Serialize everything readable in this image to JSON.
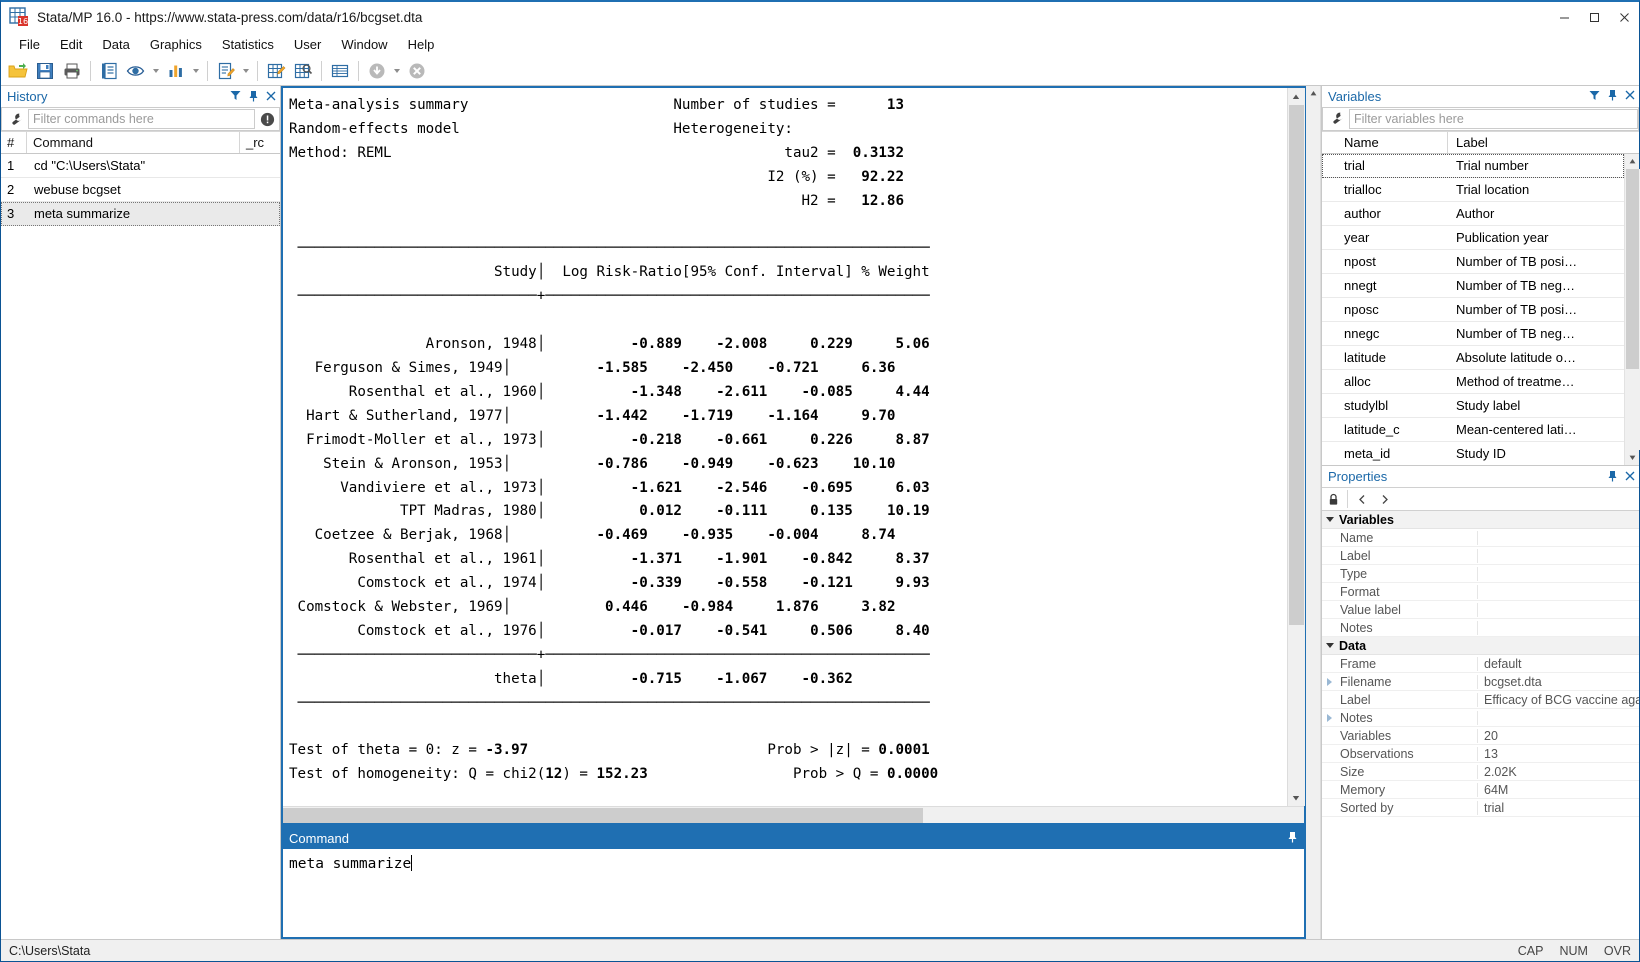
{
  "window": {
    "title": "Stata/MP 16.0 - https://www.stata-press.com/data/r16/bcgset.dta",
    "minimize": "–",
    "maximize": "☐",
    "close": "✕"
  },
  "menubar": {
    "items": [
      "File",
      "Edit",
      "Data",
      "Graphics",
      "Statistics",
      "User",
      "Window",
      "Help"
    ]
  },
  "toolbar": {
    "icons": [
      "open-folder-icon",
      "save-icon",
      "print-icon",
      "log-icon",
      "viewer-icon",
      "graph-icon",
      "do-editor-icon",
      "data-editor-edit-icon",
      "data-editor-browse-icon",
      "variables-manager-icon",
      "break-icon",
      "stop-icon"
    ]
  },
  "history": {
    "title": "History",
    "filter_placeholder": "Filter commands here",
    "columns": {
      "num": "#",
      "command": "Command",
      "rc": "_rc"
    },
    "rows": [
      {
        "num": "1",
        "command": "cd \"C:\\Users\\Stata\"",
        "rc": ""
      },
      {
        "num": "2",
        "command": "webuse bcgset",
        "rc": ""
      },
      {
        "num": "3",
        "command": "meta summarize",
        "rc": ""
      }
    ]
  },
  "results": {
    "text": "Meta-analysis summary                       Number of studies =      |13|\nRandom-effects model                        Heterogeneity:\nMethod: REML                                             tau2 =  |0.3132|\n                                                       I2 (%) =   |92.22|\n                                                          H2 =   |12.86|\n\n  ------------------------------------------------------------------------\n                      Study | Log Risk-Ratio    [95% Conf. Interval] % Weight\n  --------------------------+---------------------------------------------\n             Aronson, 1948  |        |-0.889|        |-2.008|        |0.229|     |5.06|\n     Ferguson & Simes, 1949 |        |-1.585|        |-2.450|       |-0.721|     |6.36|\n     Rosenthal et al., 1960 |        |-1.348|        |-2.611|       |-0.085|     |4.44|\n     Hart & Sutherland, 1977|        |-1.442|        |-1.719|       |-1.164|     |9.70|\nFrimodt-Moller et al., 1973 |        |-0.218|        |-0.661|        |0.226|     |8.87|\n       Stein & Aronson, 1953|        |-0.786|        |-0.949|       |-0.623|    |10.10|\n    Vandiviere et al., 1973 |        |-1.621|        |-2.546|       |-0.695|     |6.03|\n            TPT Madras, 1980|         |0.012|        |-0.111|        |0.135|    |10.19|\n     Coetzee & Berjak, 1968 |        |-0.469|        |-0.935|       |-0.004|     |8.74|\n     Rosenthal et al., 1961 |        |-1.371|        |-1.901|       |-0.842|     |8.37|\n     Comstock et al., 1974  |        |-0.339|        |-0.558|       |-0.121|     |9.93|\n   Comstock & Webster, 1969 |         |0.446|        |-0.984|        |1.876|     |3.82|\n     Comstock et al., 1976  |        |-0.017|        |-0.541|        |0.506|     |8.40|\n  --------------------------+---------------------------------------------\n                      theta |        |-0.715|        |-1.067|       |-0.362|\n  ------------------------------------------------------------------------"
  },
  "output": {
    "header_left": [
      "Meta-analysis summary",
      "Random-effects model",
      "Method: REML"
    ],
    "header_right": [
      {
        "label": "Number of studies =",
        "value": "13"
      },
      {
        "label": "Heterogeneity:",
        "value": ""
      },
      {
        "label": "tau2 =",
        "value": "0.3132"
      },
      {
        "label": "I2 (%) =",
        "value": "92.22"
      },
      {
        "label": "H2 =",
        "value": "12.86"
      }
    ],
    "table_headers": [
      "Study",
      "Log Risk-Ratio",
      "[95% Conf. Interval]",
      "% Weight"
    ],
    "rows": [
      {
        "study": "Aronson, 1948",
        "est": "-0.889",
        "ll": "-2.008",
        "ul": "0.229",
        "weight": "5.06"
      },
      {
        "study": "Ferguson & Simes, 1949",
        "est": "-1.585",
        "ll": "-2.450",
        "ul": "-0.721",
        "weight": "6.36"
      },
      {
        "study": "Rosenthal et al., 1960",
        "est": "-1.348",
        "ll": "-2.611",
        "ul": "-0.085",
        "weight": "4.44"
      },
      {
        "study": "Hart & Sutherland, 1977",
        "est": "-1.442",
        "ll": "-1.719",
        "ul": "-1.164",
        "weight": "9.70"
      },
      {
        "study": "Frimodt-Moller et al., 1973",
        "est": "-0.218",
        "ll": "-0.661",
        "ul": "0.226",
        "weight": "8.87"
      },
      {
        "study": "Stein & Aronson, 1953",
        "est": "-0.786",
        "ll": "-0.949",
        "ul": "-0.623",
        "weight": "10.10"
      },
      {
        "study": "Vandiviere et al., 1973",
        "est": "-1.621",
        "ll": "-2.546",
        "ul": "-0.695",
        "weight": "6.03"
      },
      {
        "study": "TPT Madras, 1980",
        "est": "0.012",
        "ll": "-0.111",
        "ul": "0.135",
        "weight": "10.19"
      },
      {
        "study": "Coetzee & Berjak, 1968",
        "est": "-0.469",
        "ll": "-0.935",
        "ul": "-0.004",
        "weight": "8.74"
      },
      {
        "study": "Rosenthal et al., 1961",
        "est": "-1.371",
        "ll": "-1.901",
        "ul": "-0.842",
        "weight": "8.37"
      },
      {
        "study": "Comstock et al., 1974",
        "est": "-0.339",
        "ll": "-0.558",
        "ul": "-0.121",
        "weight": "9.93"
      },
      {
        "study": "Comstock & Webster, 1969",
        "est": "0.446",
        "ll": "-0.984",
        "ul": "1.876",
        "weight": "3.82"
      },
      {
        "study": "Comstock et al., 1976",
        "est": "-0.017",
        "ll": "-0.541",
        "ul": "0.506",
        "weight": "8.40"
      }
    ],
    "overall": {
      "study": "theta",
      "est": "-0.715",
      "ll": "-1.067",
      "ul": "-0.362",
      "weight": ""
    },
    "tests": [
      {
        "left_label": "Test of theta = 0: z =",
        "left_value": "-3.97",
        "right_label": "Prob > |z| =",
        "right_value": "0.0001"
      },
      {
        "left_label": "Test of homogeneity: Q = chi2(",
        "left_value": "12",
        "left_label2": ") =",
        "left_value2": "152.23",
        "right_label": "Prob > Q =",
        "right_value": "0.0000"
      }
    ],
    "prompt": "."
  },
  "command": {
    "title": "Command",
    "pin_icon": "pin-icon",
    "value": "meta summarize"
  },
  "variables": {
    "title": "Variables",
    "filter_placeholder": "Filter variables here",
    "columns": {
      "name": "Name",
      "label": "Label"
    },
    "rows": [
      {
        "name": "trial",
        "label": "Trial number",
        "selected": true
      },
      {
        "name": "trialloc",
        "label": "Trial location",
        "selected": false
      },
      {
        "name": "author",
        "label": "Author",
        "selected": false
      },
      {
        "name": "year",
        "label": "Publication year",
        "selected": false
      },
      {
        "name": "npost",
        "label": "Number of TB posi…",
        "selected": false
      },
      {
        "name": "nnegt",
        "label": "Number of TB neg…",
        "selected": false
      },
      {
        "name": "nposc",
        "label": "Number of TB posi…",
        "selected": false
      },
      {
        "name": "nnegc",
        "label": "Number of TB neg…",
        "selected": false
      },
      {
        "name": "latitude",
        "label": "Absolute latitude o…",
        "selected": false
      },
      {
        "name": "alloc",
        "label": "Method of treatme…",
        "selected": false
      },
      {
        "name": "studylbl",
        "label": "Study label",
        "selected": false
      },
      {
        "name": "latitude_c",
        "label": "Mean-centered lati…",
        "selected": false
      },
      {
        "name": "meta_id",
        "label": "Study ID",
        "selected": false
      }
    ]
  },
  "properties": {
    "title": "Properties",
    "toolbar_icons": [
      "lock-icon",
      "chevron-left-icon",
      "chevron-right-icon"
    ],
    "groups": [
      {
        "name": "Variables",
        "rows": [
          {
            "key": "Name",
            "value": "",
            "expandable": false
          },
          {
            "key": "Label",
            "value": "",
            "expandable": false
          },
          {
            "key": "Type",
            "value": "",
            "expandable": false
          },
          {
            "key": "Format",
            "value": "",
            "expandable": false
          },
          {
            "key": "Value label",
            "value": "",
            "expandable": false
          },
          {
            "key": "Notes",
            "value": "",
            "expandable": false
          }
        ]
      },
      {
        "name": "Data",
        "rows": [
          {
            "key": "Frame",
            "value": "default",
            "expandable": false
          },
          {
            "key": "Filename",
            "value": "bcgset.dta",
            "expandable": true
          },
          {
            "key": "Label",
            "value": "Efficacy of BCG vaccine again",
            "expandable": false
          },
          {
            "key": "Notes",
            "value": "",
            "expandable": true
          },
          {
            "key": "Variables",
            "value": "20",
            "expandable": false
          },
          {
            "key": "Observations",
            "value": "13",
            "expandable": false
          },
          {
            "key": "Size",
            "value": "2.02K",
            "expandable": false
          },
          {
            "key": "Memory",
            "value": "64M",
            "expandable": false
          },
          {
            "key": "Sorted by",
            "value": "trial",
            "expandable": false
          }
        ]
      }
    ]
  },
  "statusbar": {
    "path": "C:\\Users\\Stata",
    "indicators": [
      "CAP",
      "NUM",
      "OVR"
    ]
  },
  "colors": {
    "accent": "#1f6fb2",
    "panel_title": "#1b68a8",
    "selection": "#eaeaea",
    "toolbar_yellow": "#f0b429",
    "toolbar_blue": "#1f6fb2"
  }
}
